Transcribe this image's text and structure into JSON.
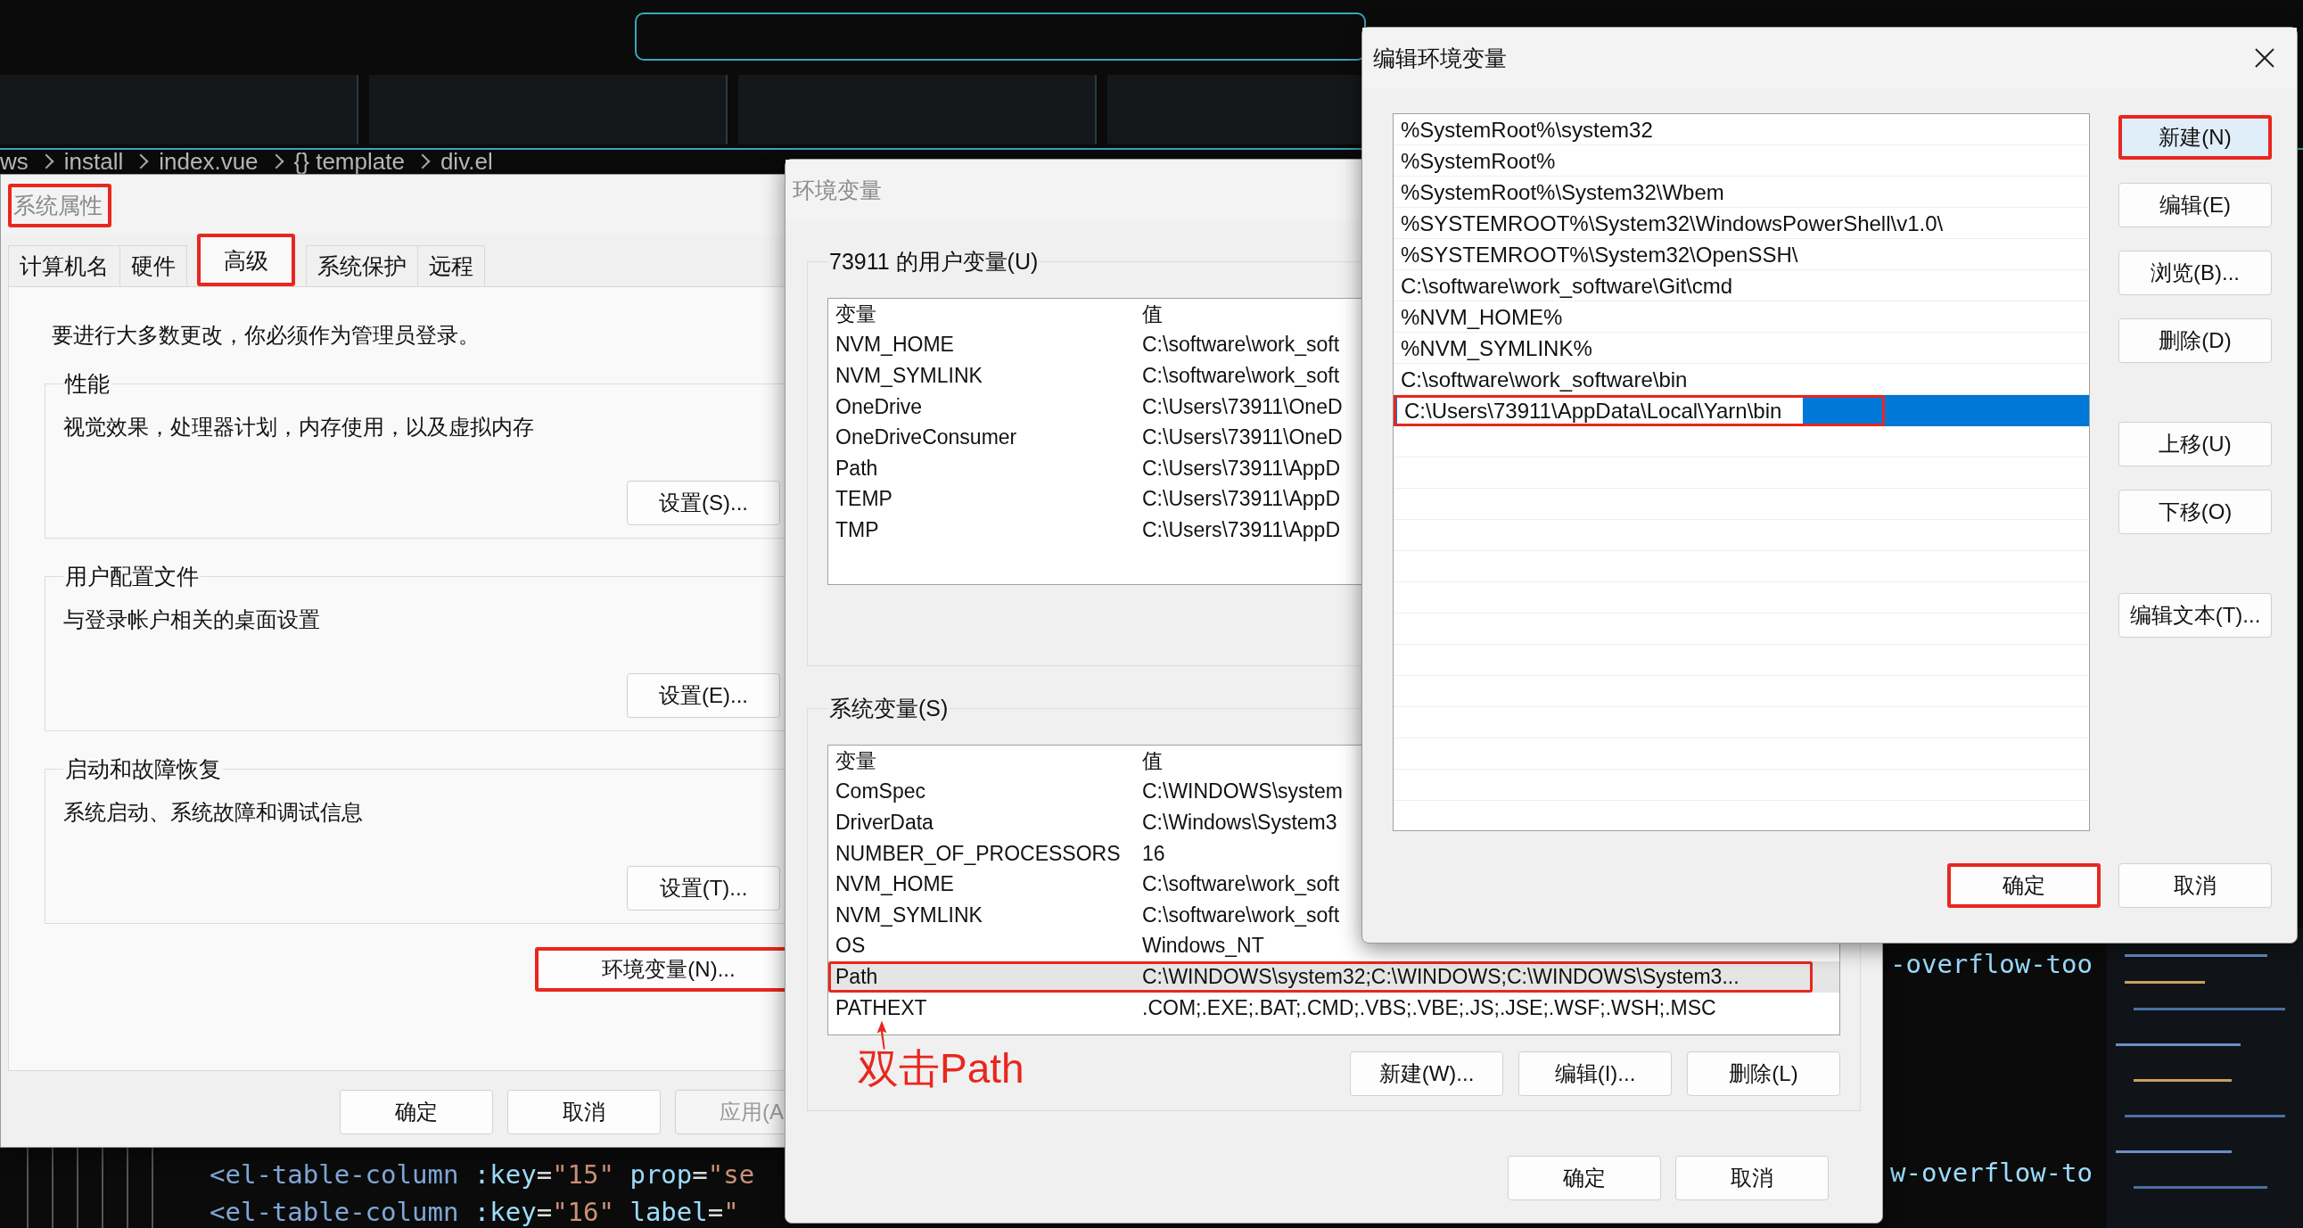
{
  "editor": {
    "breadcrumb": [
      "ws",
      "install",
      "index.vue",
      "{} template",
      "div.el"
    ],
    "code_lines": [
      {
        "segments": [
          {
            "kind": "tag",
            "text": "<el-table-column"
          },
          {
            "kind": "attr",
            "text": " :key"
          },
          {
            "kind": "punct",
            "text": "="
          },
          {
            "kind": "string",
            "text": "\"15\""
          },
          {
            "kind": "attr",
            "text": " prop"
          },
          {
            "kind": "punct",
            "text": "="
          },
          {
            "kind": "string",
            "text": "\"se"
          }
        ]
      },
      {
        "segments": [
          {
            "kind": "tag",
            "text": "<el-table-column"
          },
          {
            "kind": "attr",
            "text": " :key"
          },
          {
            "kind": "punct",
            "text": "="
          },
          {
            "kind": "string",
            "text": "\"16\""
          },
          {
            "kind": "attr",
            "text": " label"
          },
          {
            "kind": "punct",
            "text": "="
          },
          {
            "kind": "string",
            "text": "\""
          }
        ]
      }
    ],
    "overflow_fragments": [
      "-overflow-too",
      "w-overflow-to"
    ]
  },
  "system_properties": {
    "title": {
      "text": "系统属性",
      "highlighted": true
    },
    "tabs": [
      {
        "label": "计算机名",
        "selected": false,
        "highlighted": false
      },
      {
        "label": "硬件",
        "selected": false,
        "highlighted": false
      },
      {
        "label": "高级",
        "selected": true,
        "highlighted": true
      },
      {
        "label": "系统保护",
        "selected": false,
        "highlighted": false
      },
      {
        "label": "远程",
        "selected": false,
        "highlighted": false
      }
    ],
    "notice": "要进行大多数更改，你必须作为管理员登录。",
    "groups": [
      {
        "title": "性能",
        "description": "视觉效果，处理器计划，内存使用，以及虚拟内存",
        "button": "设置(S)..."
      },
      {
        "title": "用户配置文件",
        "description": "与登录帐户相关的桌面设置",
        "button": "设置(E)..."
      },
      {
        "title": "启动和故障恢复",
        "description": "系统启动、系统故障和调试信息",
        "button": "设置(T)..."
      }
    ],
    "env_button": {
      "label": "环境变量(N)...",
      "highlighted": true
    },
    "buttons": [
      {
        "label": "确定",
        "disabled": false
      },
      {
        "label": "取消",
        "disabled": false
      },
      {
        "label": "应用(A",
        "disabled": true
      }
    ]
  },
  "environment_variables": {
    "title": "环境变量",
    "user_section": {
      "label": "73911 的用户变量(U)",
      "columns": [
        "变量",
        "值"
      ],
      "rows": [
        {
          "name": "NVM_HOME",
          "value": "C:\\software\\work_soft",
          "selected": false,
          "highlighted": false
        },
        {
          "name": "NVM_SYMLINK",
          "value": "C:\\software\\work_soft",
          "selected": false,
          "highlighted": false
        },
        {
          "name": "OneDrive",
          "value": "C:\\Users\\73911\\OneD",
          "selected": false,
          "highlighted": false
        },
        {
          "name": "OneDriveConsumer",
          "value": "C:\\Users\\73911\\OneD",
          "selected": false,
          "highlighted": false
        },
        {
          "name": "Path",
          "value": "C:\\Users\\73911\\AppD",
          "selected": false,
          "highlighted": false
        },
        {
          "name": "TEMP",
          "value": "C:\\Users\\73911\\AppD",
          "selected": false,
          "highlighted": false
        },
        {
          "name": "TMP",
          "value": "C:\\Users\\73911\\AppD",
          "selected": false,
          "highlighted": false
        }
      ]
    },
    "system_section": {
      "label": "系统变量(S)",
      "columns": [
        "变量",
        "值"
      ],
      "rows": [
        {
          "name": "ComSpec",
          "value": "C:\\WINDOWS\\system",
          "selected": false,
          "highlighted": false
        },
        {
          "name": "DriverData",
          "value": "C:\\Windows\\System3",
          "selected": false,
          "highlighted": false
        },
        {
          "name": "NUMBER_OF_PROCESSORS",
          "value": "16",
          "selected": false,
          "highlighted": false
        },
        {
          "name": "NVM_HOME",
          "value": "C:\\software\\work_soft",
          "selected": false,
          "highlighted": false
        },
        {
          "name": "NVM_SYMLINK",
          "value": "C:\\software\\work_soft",
          "selected": false,
          "highlighted": false
        },
        {
          "name": "OS",
          "value": "Windows_NT",
          "selected": false,
          "highlighted": false
        },
        {
          "name": "Path",
          "value": "C:\\WINDOWS\\system32;C:\\WINDOWS;C:\\WINDOWS\\System3...",
          "selected": true,
          "highlighted": true
        },
        {
          "name": "PATHEXT",
          "value": ".COM;.EXE;.BAT;.CMD;.VBS;.VBE;.JS;.JSE;.WSF;.WSH;.MSC",
          "selected": false,
          "highlighted": false
        }
      ],
      "buttons": [
        "新建(W)...",
        "编辑(I)...",
        "删除(L)"
      ]
    },
    "buttons": [
      "确定",
      "取消"
    ]
  },
  "edit_environment_variable": {
    "title": "编辑环境变量",
    "items": [
      {
        "text": "%SystemRoot%\\system32",
        "selected": false
      },
      {
        "text": "%SystemRoot%",
        "selected": false
      },
      {
        "text": "%SystemRoot%\\System32\\Wbem",
        "selected": false
      },
      {
        "text": "%SYSTEMROOT%\\System32\\WindowsPowerShell\\v1.0\\",
        "selected": false
      },
      {
        "text": "%SYSTEMROOT%\\System32\\OpenSSH\\",
        "selected": false
      },
      {
        "text": "C:\\software\\work_software\\Git\\cmd",
        "selected": false
      },
      {
        "text": "%NVM_HOME%",
        "selected": false
      },
      {
        "text": "%NVM_SYMLINK%",
        "selected": false
      },
      {
        "text": "C:\\software\\work_software\\bin",
        "selected": false
      },
      {
        "text": "C:\\Users\\73911\\AppData\\Local\\Yarn\\bin",
        "selected": true
      }
    ],
    "side_button_groups": [
      [
        {
          "label": "新建(N)",
          "focused": true,
          "highlighted": true
        },
        {
          "label": "编辑(E)",
          "focused": false,
          "highlighted": false
        },
        {
          "label": "浏览(B)...",
          "focused": false,
          "highlighted": false
        },
        {
          "label": "删除(D)",
          "focused": false,
          "highlighted": false
        }
      ],
      [
        {
          "label": "上移(U)",
          "focused": false,
          "highlighted": false
        },
        {
          "label": "下移(O)",
          "focused": false,
          "highlighted": false
        }
      ],
      [
        {
          "label": "编辑文本(T)...",
          "focused": false,
          "highlighted": false
        }
      ]
    ],
    "buttons": [
      {
        "label": "确定",
        "highlighted": true
      },
      {
        "label": "取消",
        "highlighted": false
      }
    ]
  },
  "annotation": {
    "text": "双击Path"
  }
}
